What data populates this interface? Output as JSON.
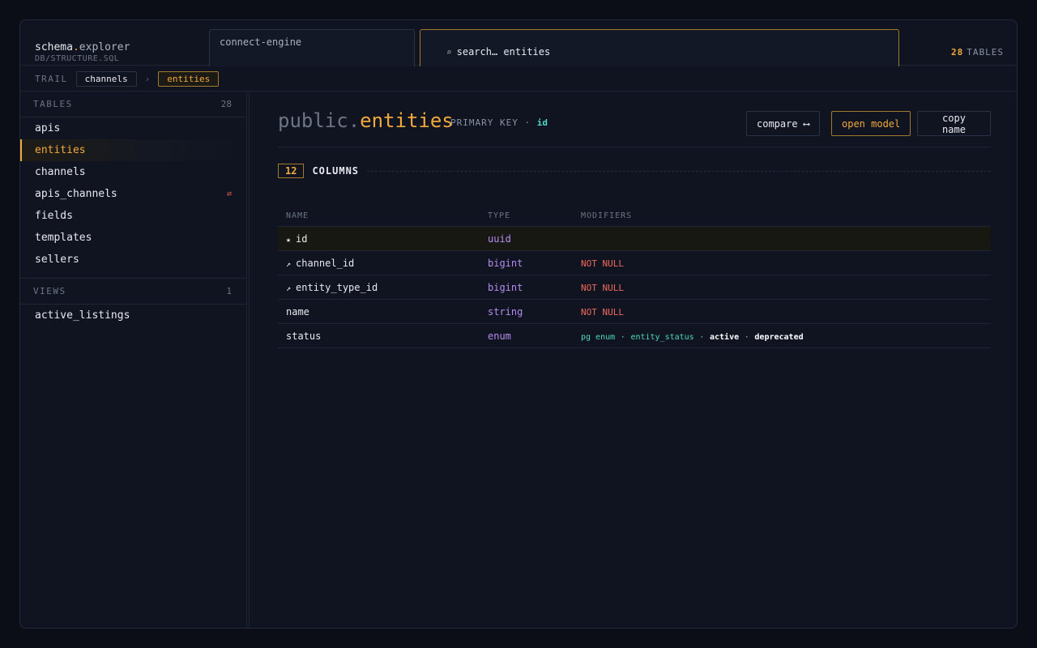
{
  "brand": {
    "name_a": "schema",
    "name_dot": ".",
    "name_b": "explorer",
    "sub": "DB/STRUCTURE.SQL"
  },
  "connection_tab": {
    "label": "connect-engine"
  },
  "search": {
    "icon": "search-icon",
    "value": "search… entities"
  },
  "table_count": {
    "number": "28",
    "label": "TABLES"
  },
  "trail": {
    "label": "TRAIL",
    "crumbs": [
      "channels",
      "entities"
    ],
    "separator": "›"
  },
  "sidebar": {
    "tables_label": "TABLES",
    "tables_count": "28",
    "tables": [
      {
        "label": "apis"
      },
      {
        "label": "entities",
        "active": true
      },
      {
        "label": "channels"
      },
      {
        "label": "apis_channels",
        "flag": "⇄"
      },
      {
        "label": "fields"
      },
      {
        "label": "templates"
      },
      {
        "label": "sellers"
      }
    ],
    "views_label": "VIEWS",
    "views_count": "1",
    "views": [
      {
        "label": "active_listings"
      }
    ]
  },
  "main": {
    "schema": "public.",
    "table": "entities",
    "pk_label": "PRIMARY KEY ·",
    "pk_value": "id",
    "buttons": {
      "compare": "compare ⟷",
      "open_model": "open model",
      "copy_name": "copy name"
    },
    "columns_count": "12",
    "columns_label": "COLUMNS",
    "headers": {
      "name": "NAME",
      "type": "TYPE",
      "modifiers": "MODIFIERS"
    },
    "rows": [
      {
        "glyph": "★",
        "name": "id",
        "type": "uuid",
        "mod": ""
      },
      {
        "glyph": "↗",
        "name": "channel_id",
        "type": "bigint",
        "mod": "NOT NULL"
      },
      {
        "glyph": "↗",
        "name": "entity_type_id",
        "type": "bigint",
        "mod": "NOT NULL"
      },
      {
        "glyph": "",
        "name": "name",
        "type": "string",
        "mod": "NOT NULL"
      },
      {
        "glyph": "",
        "name": "status",
        "type": "enum",
        "mod": ""
      }
    ],
    "enum_mod": {
      "a": "pg enum",
      "sep": "·",
      "b": "entity_status",
      "c": "active",
      "d": "deprecated"
    }
  },
  "colors": {
    "accent": "#f2a93b",
    "type": "#b48cf0",
    "teal": "#4fd8c4",
    "red": "#f26a5a"
  }
}
